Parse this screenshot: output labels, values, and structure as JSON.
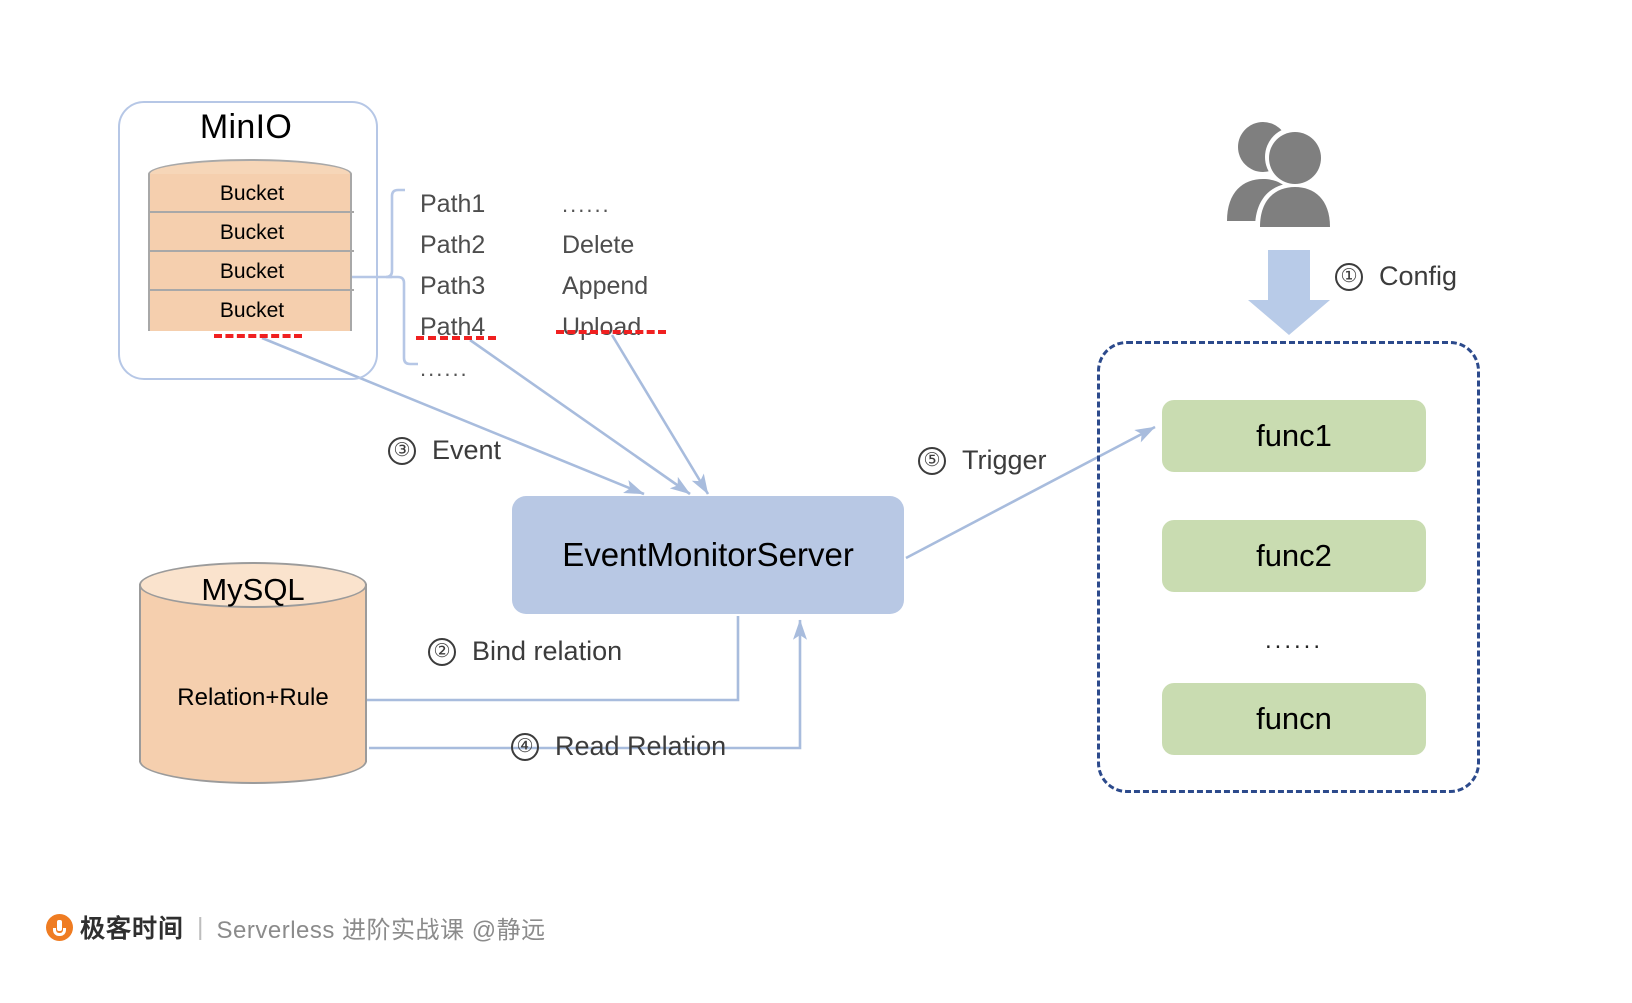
{
  "diagram": {
    "minio": {
      "title": "MinIO",
      "buckets": [
        "Bucket",
        "Bucket",
        "Bucket",
        "Bucket"
      ]
    },
    "paths": {
      "items": [
        "Path1",
        "Path2",
        "Path3",
        "Path4",
        "......"
      ]
    },
    "operations": {
      "items": [
        "......",
        "Delete",
        "Append",
        "Upload"
      ]
    },
    "event_monitor_server": {
      "label": "EventMonitorServer"
    },
    "mysql": {
      "title": "MySQL",
      "content": "Relation+Rule"
    },
    "functions": {
      "items": [
        "func1",
        "func2",
        "funcn"
      ],
      "ellipsis": "......"
    },
    "actors": {
      "icon": "users-icon"
    },
    "steps": [
      {
        "num": "①",
        "label": "Config"
      },
      {
        "num": "②",
        "label": "Bind relation"
      },
      {
        "num": "③",
        "label": "Event"
      },
      {
        "num": "④",
        "label": "Read Relation"
      },
      {
        "num": "⑤",
        "label": "Trigger"
      }
    ],
    "colors": {
      "bucket_fill": "#f5cfae",
      "bucket_top": "#f6d6b8",
      "server_fill": "#b8c8e4",
      "func_fill": "#c9dcb1",
      "frame_border": "#b6c7e6",
      "func_container_border": "#2c4a8c",
      "arrow": "#aabdde",
      "highlight_dash": "#f02020",
      "actor_fill": "#7f7f7f",
      "brand_orange": "#ef7c22"
    }
  },
  "footer": {
    "brand_cn": "极客时间",
    "separator": "|",
    "tagline": "Serverless 进阶实战课 @静远"
  }
}
